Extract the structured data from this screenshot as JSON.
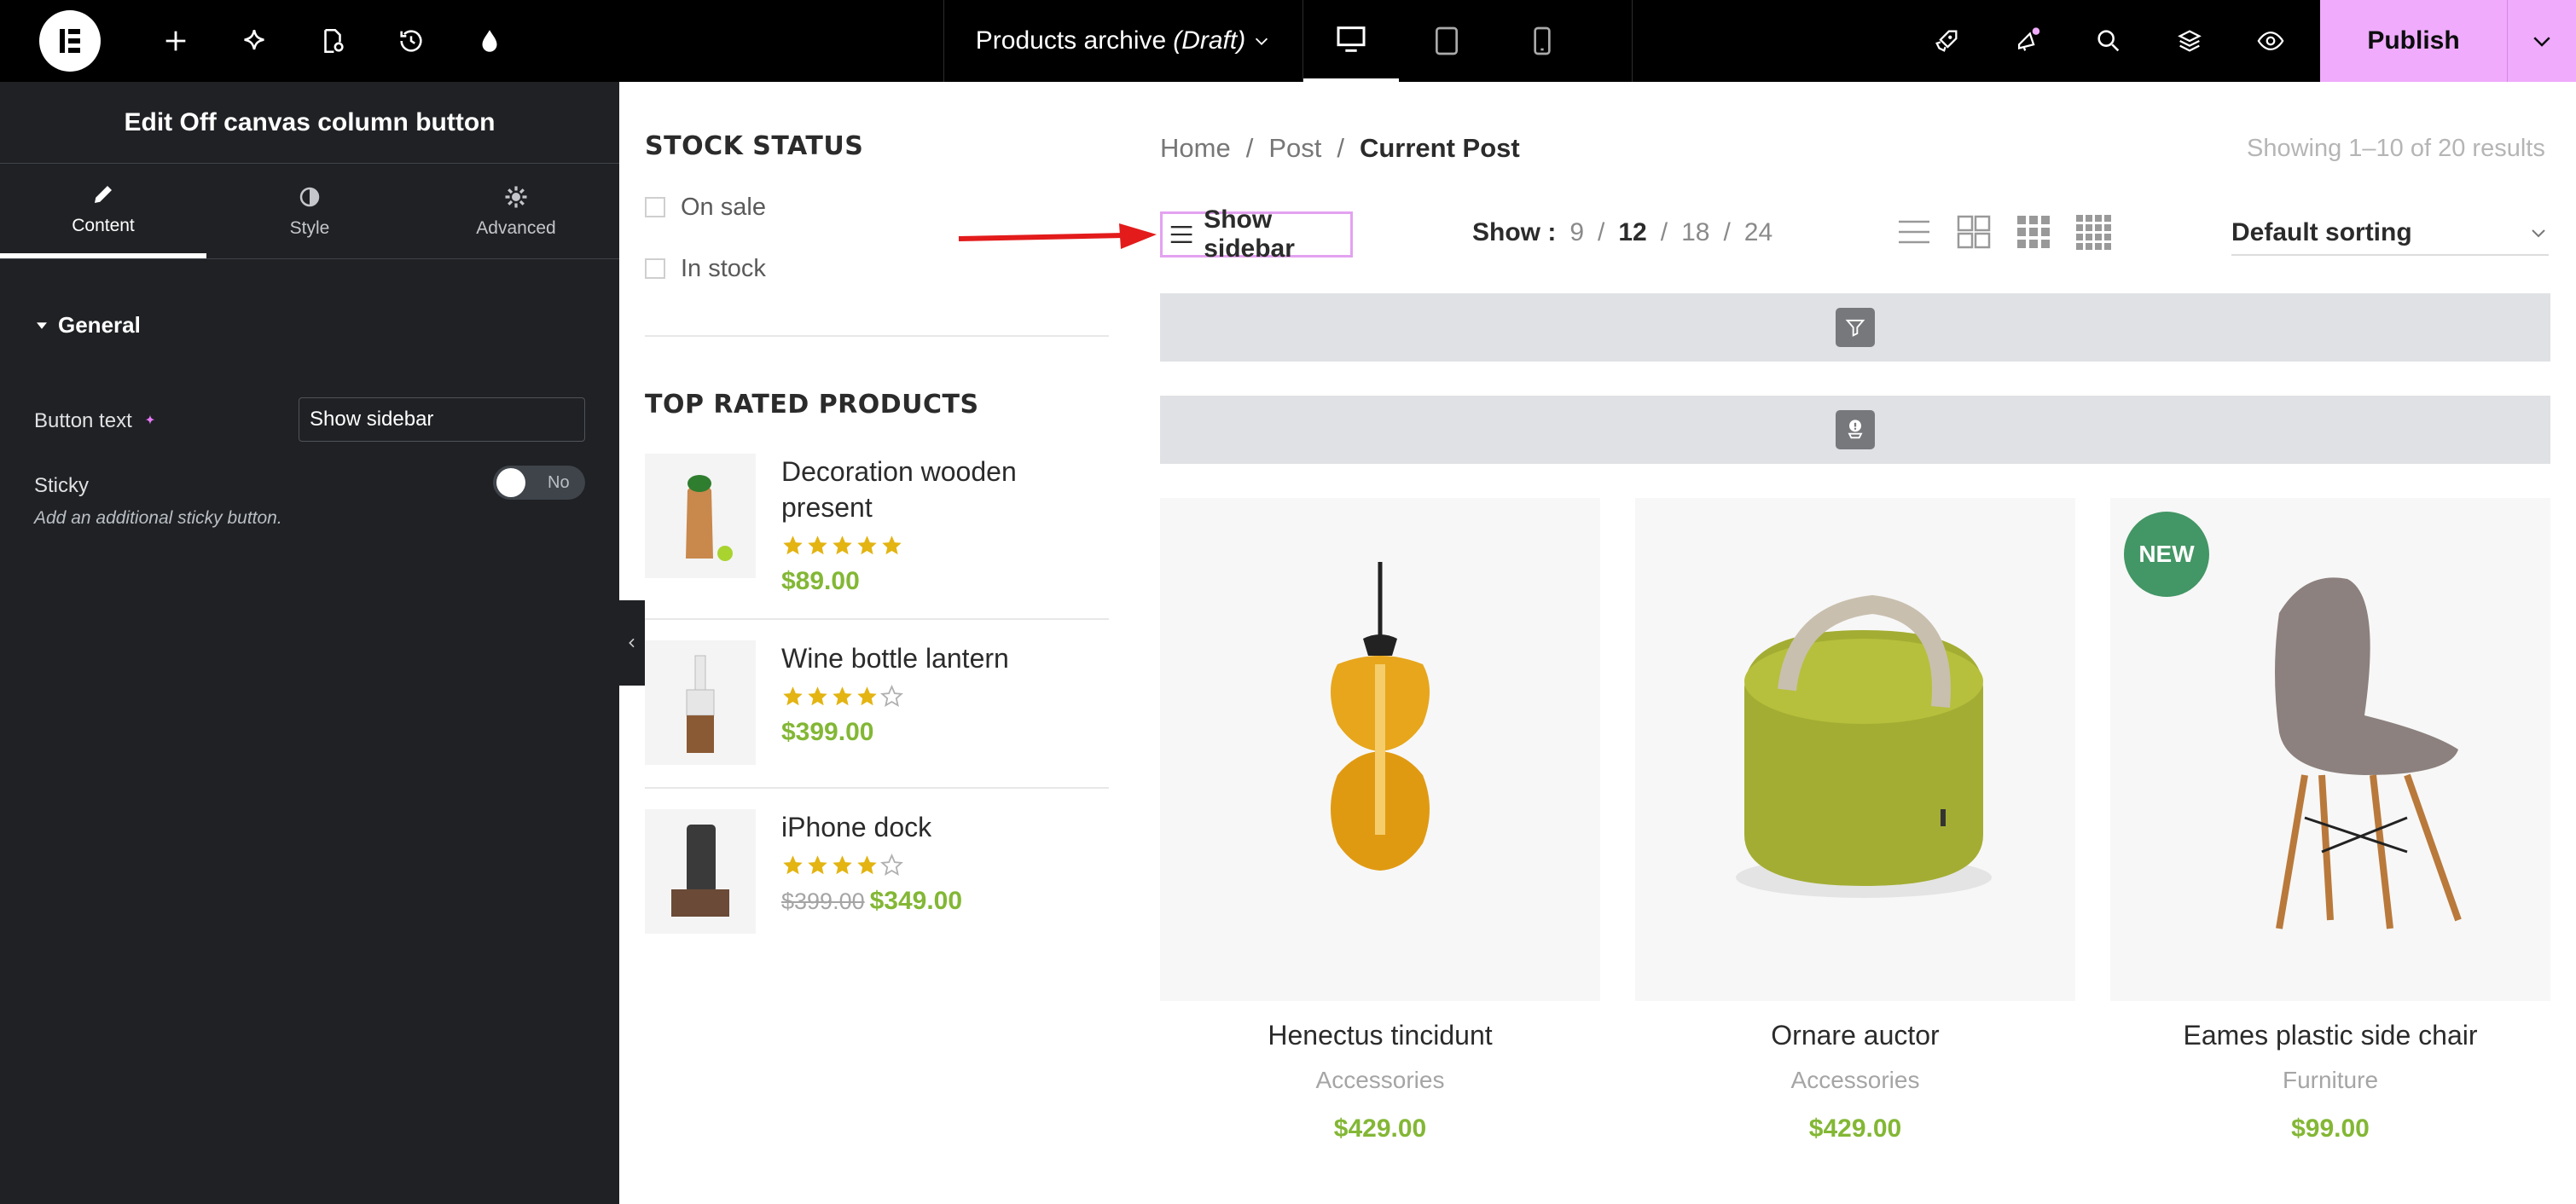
{
  "topbar": {
    "doc_title": "Products archive",
    "doc_status": "(Draft)",
    "publish_label": "Publish",
    "left_icons": [
      "add-icon",
      "ai-sparkle-icon",
      "page-settings-icon",
      "history-icon",
      "site-settings-icon"
    ],
    "right_icons": [
      "rocket-icon",
      "notifications-icon",
      "search-icon",
      "structure-layers-icon",
      "preview-eye-icon"
    ],
    "devices": [
      "desktop",
      "tablet",
      "mobile"
    ],
    "active_device": "desktop"
  },
  "panel": {
    "title": "Edit Off canvas column button",
    "tabs": [
      {
        "label": "Content",
        "icon": "pencil-icon"
      },
      {
        "label": "Style",
        "icon": "contrast-icon"
      },
      {
        "label": "Advanced",
        "icon": "gear-icon"
      }
    ],
    "active_tab": "Content",
    "section": "General",
    "button_text_label": "Button text",
    "button_text_value": "Show sidebar",
    "sticky_label": "Sticky",
    "sticky_value": "No",
    "sticky_description": "Add an additional sticky button."
  },
  "sidebar": {
    "stock_title": "STOCK STATUS",
    "stock_options": [
      "On sale",
      "In stock"
    ],
    "top_rated_title": "TOP RATED PRODUCTS",
    "top_rated": [
      {
        "name": "Decoration wooden present",
        "rating": 5,
        "price": "$89.00",
        "old_price": ""
      },
      {
        "name": "Wine bottle lantern",
        "rating": 4,
        "price": "$399.00",
        "old_price": ""
      },
      {
        "name": "iPhone dock",
        "rating": 4,
        "price": "$349.00",
        "old_price": "$399.00"
      }
    ]
  },
  "shop": {
    "breadcrumb": [
      "Home",
      "Post",
      "Current Post"
    ],
    "breadcrumb_sep": "/",
    "results_text": "Showing 1–10 of 20 results",
    "show_sidebar_label": "Show sidebar",
    "per_page_label": "Show :",
    "per_page_options": [
      "9",
      "12",
      "18",
      "24"
    ],
    "per_page_selected": "12",
    "sorting_value": "Default sorting",
    "products": [
      {
        "name": "Henectus tincidunt",
        "category": "Accessories",
        "price": "$429.00",
        "badge": ""
      },
      {
        "name": "Ornare auctor",
        "category": "Accessories",
        "price": "$429.00",
        "badge": ""
      },
      {
        "name": "Eames plastic side chair",
        "category": "Furniture",
        "price": "$99.00",
        "badge": "NEW"
      }
    ]
  },
  "colors": {
    "accent_pink": "#f0abfc",
    "price_green": "#83b735",
    "star_yellow": "#e3b412",
    "badge_green": "#439665",
    "annotation_arrow": "#e31b1b"
  }
}
